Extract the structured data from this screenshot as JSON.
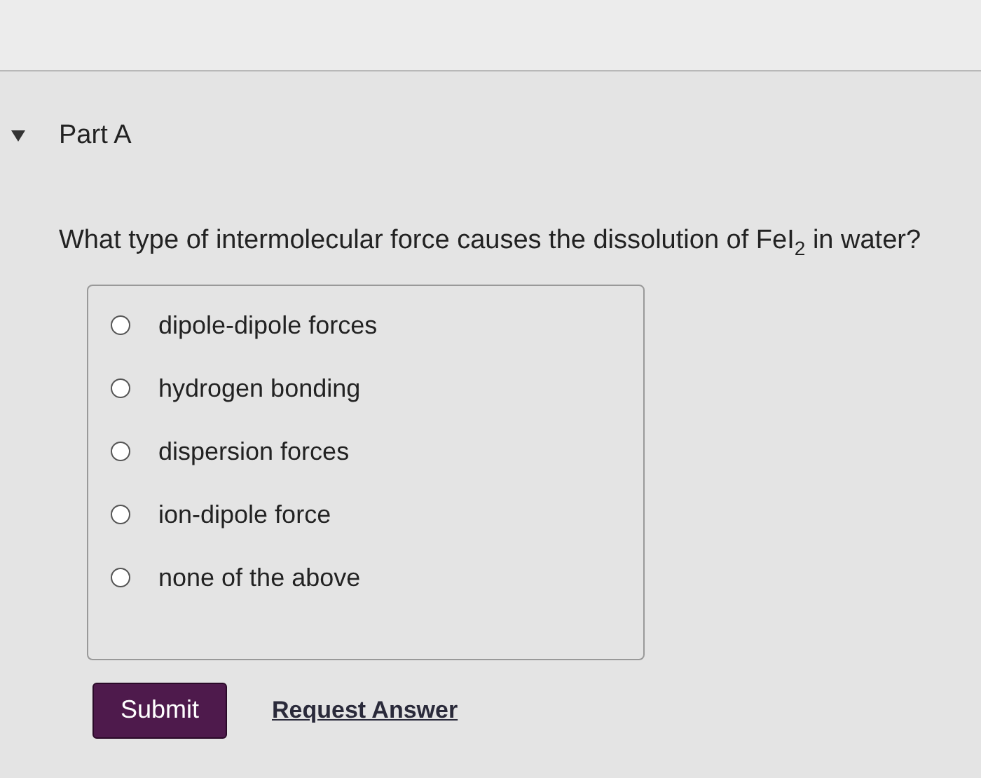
{
  "part": {
    "title": "Part A",
    "expanded": true
  },
  "question": "What type of intermolecular force causes the dissolution of FeI$_{2}$ in water?",
  "options": [
    {
      "label": "dipole-dipole forces",
      "selected": false
    },
    {
      "label": "hydrogen bonding",
      "selected": false
    },
    {
      "label": "dispersion forces",
      "selected": false
    },
    {
      "label": "ion-dipole force",
      "selected": false
    },
    {
      "label": "none of the above",
      "selected": false
    }
  ],
  "buttons": {
    "submit": "Submit",
    "request": "Request Answer"
  }
}
